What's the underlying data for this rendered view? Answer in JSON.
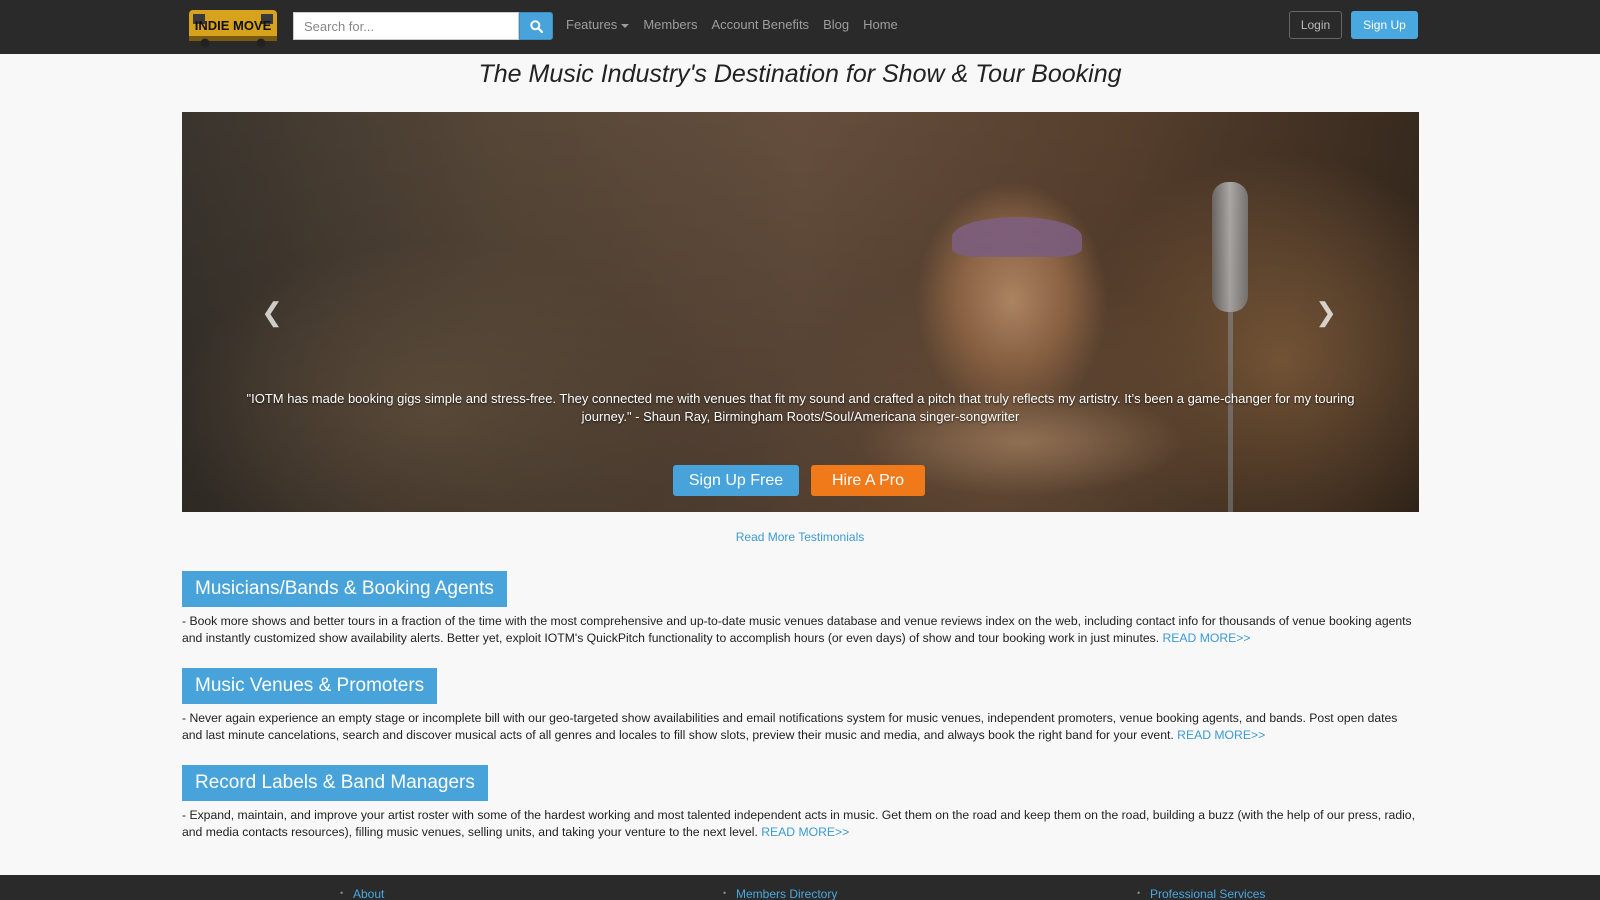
{
  "nav": {
    "logo_alt": "Indie on the Move",
    "search_placeholder": "Search for...",
    "links": [
      "Features",
      "Members",
      "Account Benefits",
      "Blog",
      "Home"
    ],
    "login_label": "Login",
    "signup_label": "Sign Up"
  },
  "headline": "The Music Industry's Destination for Show & Tour Booking",
  "carousel": {
    "quote": "\"IOTM has made booking gigs simple and stress-free. They connected me with venues that fit my sound and crafted a pitch that truly reflects my artistry. It’s been a game-changer for my touring journey.\" - Shaun Ray, Birmingham Roots/Soul/Americana singer-songwriter",
    "signup_free_label": "Sign Up Free",
    "hire_pro_label": "Hire A Pro"
  },
  "testimonials_link": "Read More Testimonials",
  "sections": [
    {
      "title": "Musicians/Bands & Booking Agents",
      "text": "- Book more shows and better tours in a fraction of the time with the most comprehensive and up-to-date music venues database and venue reviews index on the web, including contact info for thousands of venue booking agents and instantly customized show availability alerts. Better yet, exploit IOTM's QuickPitch functionality to accomplish hours (or even days) of show and tour booking work in just minutes.",
      "read_more": "READ MORE>>"
    },
    {
      "title": "Music Venues & Promoters",
      "text": "- Never again experience an empty stage or incomplete bill with our geo-targeted show availabilities and email notifications system for music venues, independent promoters, venue booking agents, and bands. Post open dates and last minute cancelations, search and discover musical acts of all genres and locales to fill show slots, preview their music and media, and always book the right band for your event.",
      "read_more": "READ MORE>>"
    },
    {
      "title": "Record Labels & Band Managers",
      "text": "- Expand, maintain, and improve your artist roster with some of the hardest working and most talented independent acts in music. Get them on the road and keep them on the road, building a buzz (with the help of our press, radio, and media contacts resources), filling music venues, selling units, and taking your venture to the next level.",
      "read_more": "READ MORE>>"
    }
  ],
  "footer": {
    "links": [
      "About",
      "Members Directory",
      "Professional Services"
    ]
  },
  "colors": {
    "navbar": "#2a2a2a",
    "accent_blue": "#47a3da",
    "accent_orange": "#f07a1a",
    "link_blue": "#3c9ad4"
  }
}
